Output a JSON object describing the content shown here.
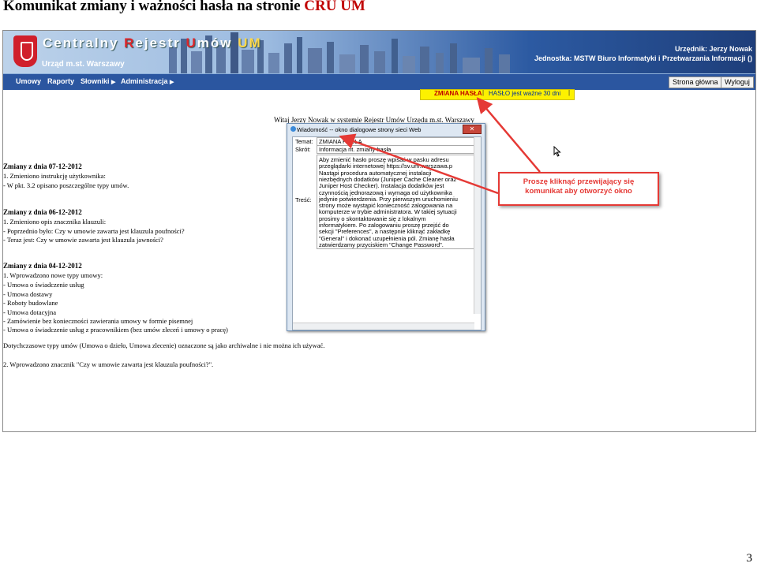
{
  "doc": {
    "title_main": "Komunikat zmiany i ważności hasła na stronie ",
    "title_accent": "CRU UM",
    "page_number": "3"
  },
  "app": {
    "brand_prefix": "Centralny ",
    "brand_r": "R",
    "brand_mid": "ejestr ",
    "brand_u": "U",
    "brand_suffix": "mów",
    "brand_um": " UM",
    "office": "Urząd m.st. Warszawy",
    "user": "Urzędnik: Jerzy Nowak",
    "unit": "Jednostka: MSTW Biuro Informatyki i Przetwarzania Informacji ()"
  },
  "menu": {
    "umowy": "Umowy",
    "raporty": "Raporty",
    "slowniki": "Słowniki",
    "administracja": "Administracja",
    "home_button": "Strona główna",
    "logout_button": "Wyloguj"
  },
  "alert": {
    "change_password": "ZMIANA HASŁA",
    "password_valid": "HASŁO jest ważne 30 dni",
    "separator": "|"
  },
  "welcome": "Witaj Jerzy Nowak w systemie Rejestr Umów Urzędu m.st. Warszawy",
  "changes": {
    "h1": "Zmiany z dnia 07-12-2012",
    "l1": "1. Zmieniono instrukcję użytkownika:",
    "l2": "  - W pkt. 3.2 opisano poszczególne typy umów.",
    "h2": "Zmiany z dnia 06-12-2012",
    "l3": "1. Zmieniono opis znacznika klauzuli:",
    "l4": "  - Poprzednio było: Czy w umowie zawarta jest klauzula poufności?",
    "l5": "  - Teraz jest: Czy w umowie zawarta jest klauzula jawności?",
    "h3": "Zmiany z dnia 04-12-2012",
    "l6": "1. Wprowadzono nowe typy umowy:",
    "l7": "  - Umowa o świadczenie usług",
    "l8": "  - Umowa dostawy",
    "l9": "  - Roboty budowlane",
    "l10": "  - Umowa dotacyjna",
    "l11": "  - Zamówienie bez konieczności zawierania umowy w formie pisemnej",
    "l12": "  - Umowa o świadczenie usług z pracownikiem (bez umów zleceń i umowy o pracę)",
    "l13": "  Dotychczasowe typy umów (Umowa o dzieło, Umowa zlecenie) oznaczone są jako archiwalne i nie można ich używać.",
    "l14": "2. Wprowadzono znacznik \"Czy w umowie zawarta jest klauzula poufności?\"."
  },
  "dialog": {
    "title": "Wiadomość -- okno dialogowe strony sieci Web",
    "close": "✕",
    "subject_label": "Temat:",
    "subject_value": "ZMIANA HASŁA",
    "summary_label": "Skrót:",
    "summary_value": "Informacja nt. zmiany hasła",
    "content_label": "Treść:",
    "content_lines": [
      "Aby zmienić hasło proszę wpisać w pasku adresu",
      "przeglądarki internetowej https://sv.um.warszawa.p",
      "Nastąpi procedura automatycznej instalacji",
      "niezbędnych dodatków (Juniper Cache Cleaner oraz",
      "Juniper Host Checker). Instalacja dodatków jest",
      "czynnością jednorazową i wymaga od użytkownika",
      "jedynie potwierdzenia. Przy pierwszym uruchomieniu",
      "strony może wystąpić konieczność zalogowania na",
      "komputerze w trybie administratora. W takiej sytuacji",
      "prosimy o skontaktowanie się z lokalnym",
      "informatykiem. Po zalogowaniu proszę przejść do",
      "sekcji \"Preferences\", a następnie kliknąć zakładkę",
      "\"General\" i dokonać uzupełnienia pól. Zmianę hasła",
      "zatwierdzamy przyciskiem \"Change Password\"."
    ]
  },
  "callout": {
    "line1": "Proszę kliknąć przewijający się",
    "line2": "komunikat aby otworzyć okno"
  },
  "colors": {
    "accent_red": "#c00000",
    "menu_blue": "#2b56a0",
    "alert_yellow": "#fdf100",
    "callout_red": "#e53935"
  }
}
